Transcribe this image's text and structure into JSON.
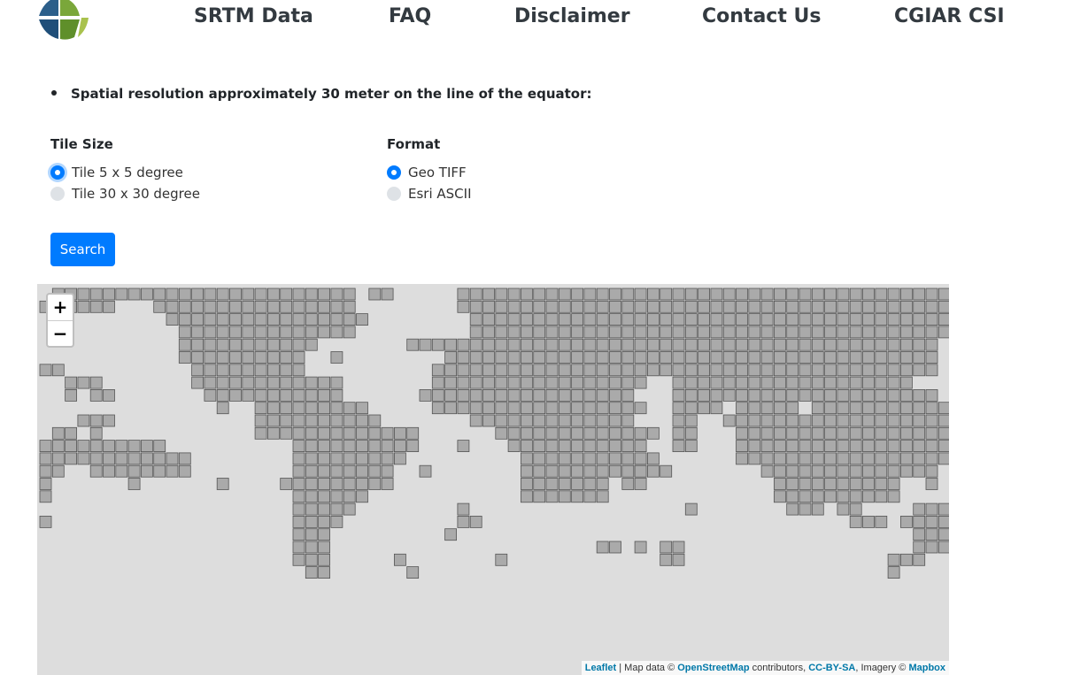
{
  "nav": {
    "items": [
      "SRTM Data",
      "FAQ",
      "Disclaimer",
      "Contact Us",
      "CGIAR CSI"
    ]
  },
  "intro": {
    "bullet": "Spatial resolution approximately 30 meter on the line of the equator:"
  },
  "tile_size": {
    "title": "Tile Size",
    "options": [
      "Tile 5 x 5 degree",
      "Tile 30 x 30 degree"
    ],
    "selected": "Tile 5 x 5 degree"
  },
  "format": {
    "title": "Format",
    "options": [
      "Geo TIFF",
      "Esri ASCII"
    ],
    "selected": "Geo TIFF"
  },
  "search_label": "Search",
  "map": {
    "zoom_in": "+",
    "zoom_out": "−",
    "attribution": {
      "leaflet": "Leaflet",
      "sep1": " | Map data © ",
      "osm": "OpenStreetMap",
      "sep2": " contributors, ",
      "license": "CC-BY-SA",
      "sep3": ", Imagery © ",
      "imagery": "Mapbox"
    },
    "colors": {
      "background": "#dddddd",
      "tile_fill": "#aaaaaa",
      "tile_stroke": "#555555"
    }
  }
}
